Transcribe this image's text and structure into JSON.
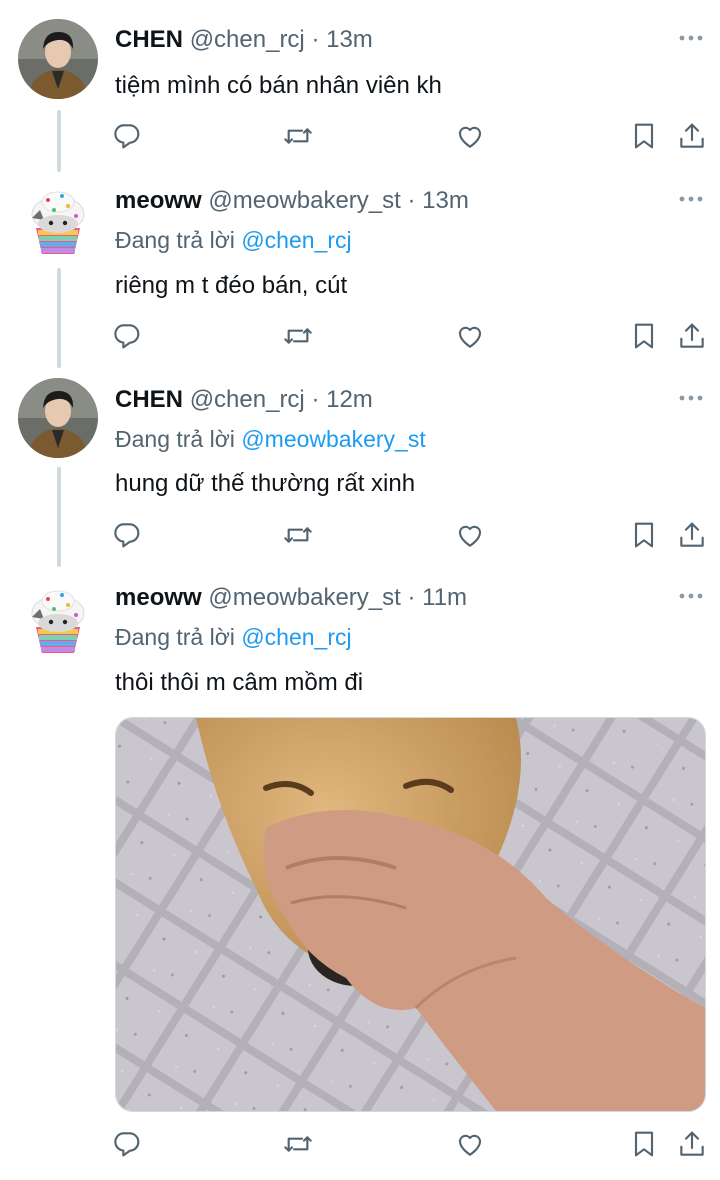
{
  "tweets": [
    {
      "name": "CHEN",
      "handle": "@chen_rcj",
      "time": "13m",
      "avatar_icon": "person-avatar-icon",
      "reply_prefix": "",
      "reply_mention": "",
      "text": "tiệm mình có bán nhân viên kh"
    },
    {
      "name": "meoww",
      "handle": "@meowbakery_st",
      "time": "13m",
      "avatar_icon": "cupcake-cat-avatar-icon",
      "reply_prefix": "Đang trả lời",
      "reply_mention": "@chen_rcj",
      "text": "riêng m t đéo bán, cút"
    },
    {
      "name": "CHEN",
      "handle": "@chen_rcj",
      "time": "12m",
      "avatar_icon": "person-avatar-icon",
      "reply_prefix": "Đang trả lời",
      "reply_mention": "@meowbakery_st",
      "text": "hung dữ thế thường rất xinh"
    },
    {
      "name": "meoww",
      "handle": "@meowbakery_st",
      "time": "11m",
      "avatar_icon": "cupcake-cat-avatar-icon",
      "reply_prefix": "Đang trả lời",
      "reply_mention": "@chen_rcj",
      "text": "thôi thôi m câm mồm đi",
      "media": "dog-nose-held-by-hand-photo"
    }
  ],
  "separator": "·",
  "actions": [
    "reply-icon",
    "retweet-icon",
    "like-icon",
    "bookmark-icon",
    "share-icon"
  ],
  "colors": {
    "link": "#1d9bf0",
    "secondary_text": "#536471",
    "thread_line": "#cfd9de"
  }
}
